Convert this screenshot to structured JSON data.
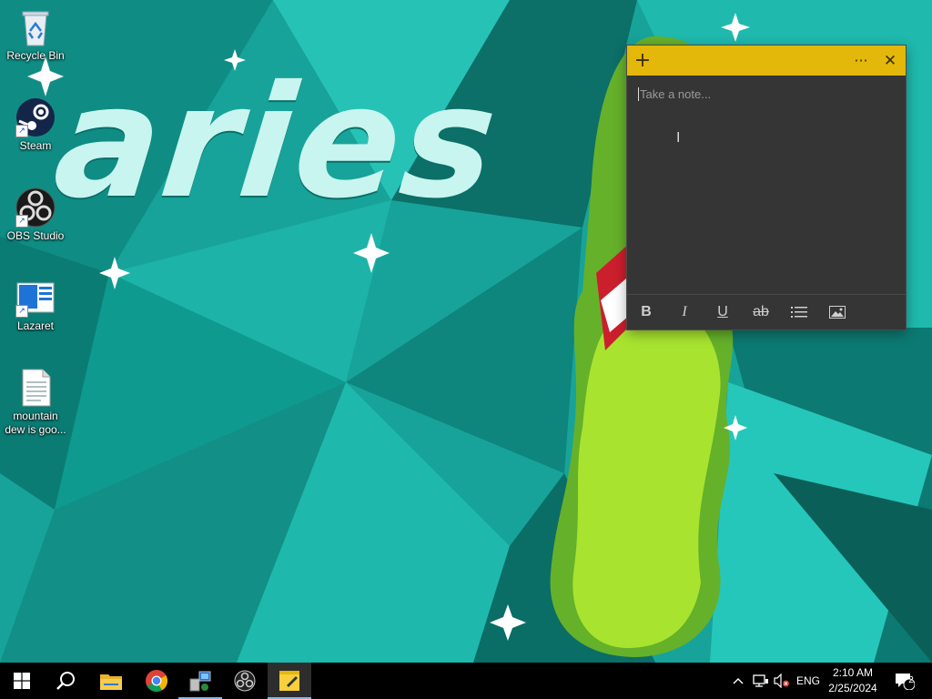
{
  "desktop": {
    "wallpaper_text": "aries",
    "icons": [
      {
        "label": "Recycle Bin",
        "icon": "recycle-bin-icon"
      },
      {
        "label": "Steam",
        "icon": "steam-icon"
      },
      {
        "label": "OBS Studio",
        "icon": "obs-icon"
      },
      {
        "label": "Lazaret",
        "icon": "lazaret-icon"
      },
      {
        "label": "mountain dew is goo...",
        "icon": "text-file-icon"
      }
    ]
  },
  "sticky_note": {
    "placeholder": "Take a note...",
    "add_button": "+",
    "menu_button": "···",
    "close_button": "✕",
    "toolbar": {
      "bold": "B",
      "italic": "I",
      "underline": "U",
      "strikethrough": "ab"
    },
    "colors": {
      "header": "#e4b70b",
      "body": "#353535"
    }
  },
  "taskbar": {
    "apps": [
      {
        "name": "start",
        "icon": "windows-logo-icon"
      },
      {
        "name": "search",
        "icon": "search-icon"
      },
      {
        "name": "file-explorer",
        "icon": "folder-icon"
      },
      {
        "name": "chrome",
        "icon": "chrome-icon"
      },
      {
        "name": "app",
        "icon": "installer-icon",
        "running": true
      },
      {
        "name": "obs",
        "icon": "obs-icon"
      },
      {
        "name": "sticky-notes",
        "icon": "sticky-notes-icon",
        "active": true
      }
    ],
    "tray": {
      "language": "ENG",
      "time": "2:10 AM",
      "date": "2/25/2024",
      "notification_count": "2"
    }
  }
}
